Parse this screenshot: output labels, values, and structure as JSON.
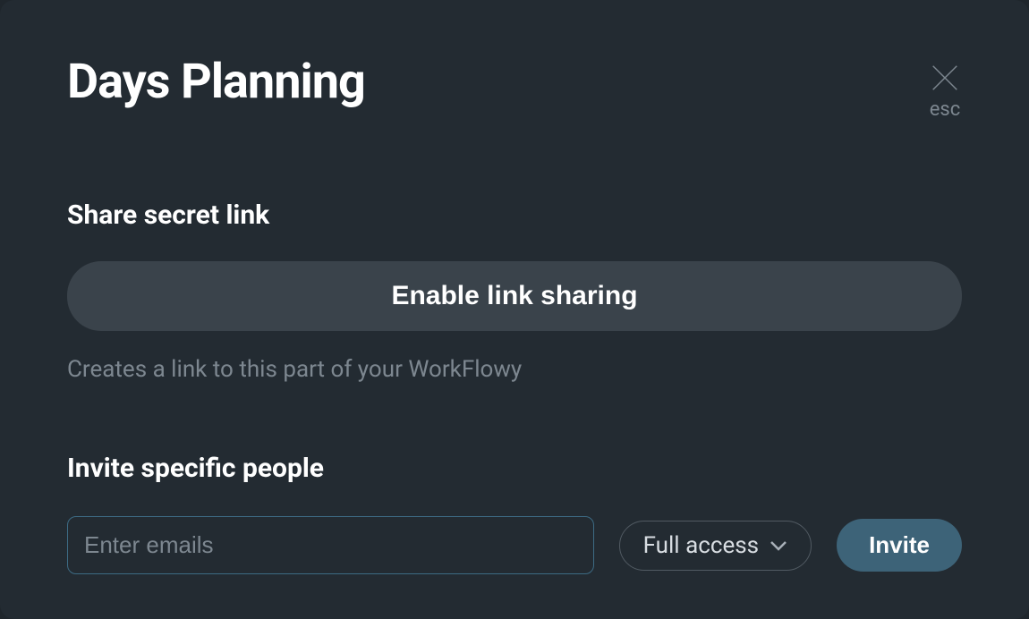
{
  "title": "Days Planning",
  "close": {
    "label": "esc"
  },
  "shareSection": {
    "heading": "Share secret link",
    "buttonLabel": "Enable link sharing",
    "helperText": "Creates a link to this part of your WorkFlowy"
  },
  "inviteSection": {
    "heading": "Invite specific people",
    "emailPlaceholder": "Enter emails",
    "accessLabel": "Full access",
    "inviteButtonLabel": "Invite"
  }
}
